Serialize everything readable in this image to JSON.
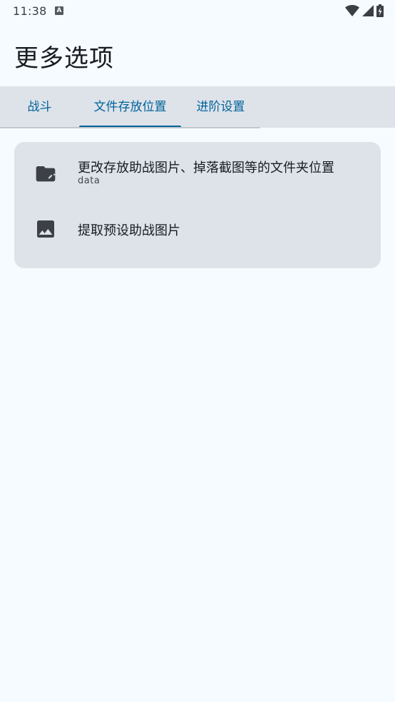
{
  "status_bar": {
    "time": "11:38",
    "notification_icon": "a-letter-icon",
    "icons": [
      "wifi-icon",
      "signal-icon",
      "battery-charging-icon"
    ]
  },
  "page": {
    "title": "更多选项"
  },
  "tabs": [
    {
      "label": "战斗",
      "selected": false
    },
    {
      "label": "文件存放位置",
      "selected": true
    },
    {
      "label": "进阶设置",
      "selected": false
    }
  ],
  "options": [
    {
      "icon": "folder-edit-icon",
      "title": "更改存放助战图片、掉落截图等的文件夹位置",
      "subtitle": "data"
    },
    {
      "icon": "image-icon",
      "title": "提取预设助战图片"
    }
  ],
  "colors": {
    "background": "#f6fbff",
    "surface_variant": "#dee3ea",
    "primary": "#00629b",
    "on_surface": "#181c20",
    "icon": "#3d4147"
  }
}
